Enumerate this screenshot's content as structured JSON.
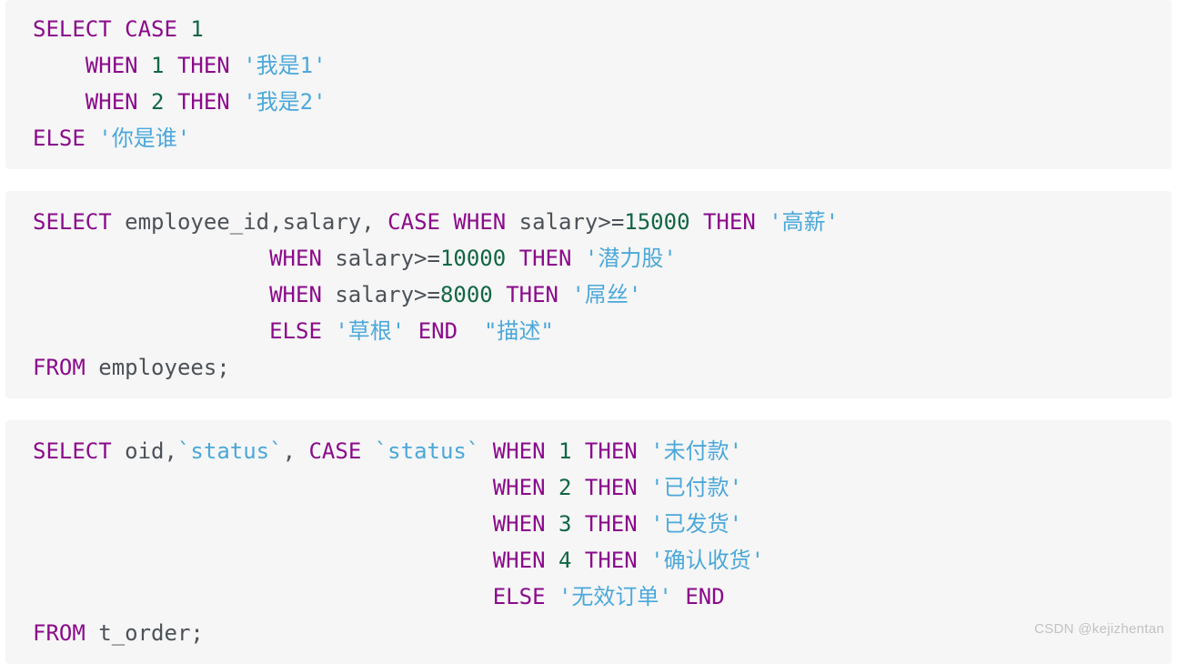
{
  "page": {
    "background_color": "#ffffff",
    "block_background_color": "#f6f6f6"
  },
  "syntax_colors": {
    "keyword": "#8b0a8b",
    "number": "#116644",
    "string": "#4ba8da",
    "identifier": "#4d5259",
    "operator": "#4d5259",
    "punctuation": "#4d5259"
  },
  "watermark": {
    "text": "CSDN @kejizhentan"
  },
  "code_blocks": [
    {
      "id": "block-case-simple",
      "plain_text": "SELECT CASE 1\n    WHEN 1 THEN '我是1'\n    WHEN 2 THEN '我是2'\nELSE '你是谁'",
      "lines": [
        {
          "indent": "",
          "tokens": [
            {
              "t": "SELECT",
              "k": "kw"
            },
            {
              "t": " ",
              "k": "pun"
            },
            {
              "t": "CASE",
              "k": "kw"
            },
            {
              "t": " ",
              "k": "pun"
            },
            {
              "t": "1",
              "k": "num"
            }
          ]
        },
        {
          "indent": "    ",
          "tokens": [
            {
              "t": "WHEN",
              "k": "kw"
            },
            {
              "t": " ",
              "k": "pun"
            },
            {
              "t": "1",
              "k": "num"
            },
            {
              "t": " ",
              "k": "pun"
            },
            {
              "t": "THEN",
              "k": "kw"
            },
            {
              "t": " ",
              "k": "pun"
            },
            {
              "t": "'我是1'",
              "k": "str"
            }
          ]
        },
        {
          "indent": "    ",
          "tokens": [
            {
              "t": "WHEN",
              "k": "kw"
            },
            {
              "t": " ",
              "k": "pun"
            },
            {
              "t": "2",
              "k": "num"
            },
            {
              "t": " ",
              "k": "pun"
            },
            {
              "t": "THEN",
              "k": "kw"
            },
            {
              "t": " ",
              "k": "pun"
            },
            {
              "t": "'我是2'",
              "k": "str"
            }
          ]
        },
        {
          "indent": "",
          "tokens": [
            {
              "t": "ELSE",
              "k": "kw"
            },
            {
              "t": " ",
              "k": "pun"
            },
            {
              "t": "'你是谁'",
              "k": "str"
            }
          ]
        }
      ]
    },
    {
      "id": "block-case-salary",
      "plain_text": "SELECT employee_id,salary, CASE WHEN salary>=15000 THEN '高薪'\n                  WHEN salary>=10000 THEN '潜力股'\n                  WHEN salary>=8000 THEN '屌丝'\n                  ELSE '草根' END  \"描述\"\nFROM employees;",
      "lines": [
        {
          "indent": "",
          "tokens": [
            {
              "t": "SELECT",
              "k": "kw"
            },
            {
              "t": " ",
              "k": "pun"
            },
            {
              "t": "employee_id",
              "k": "id"
            },
            {
              "t": ",",
              "k": "pun"
            },
            {
              "t": "salary",
              "k": "id"
            },
            {
              "t": ", ",
              "k": "pun"
            },
            {
              "t": "CASE",
              "k": "kw"
            },
            {
              "t": " ",
              "k": "pun"
            },
            {
              "t": "WHEN",
              "k": "kw"
            },
            {
              "t": " ",
              "k": "pun"
            },
            {
              "t": "salary",
              "k": "id"
            },
            {
              "t": ">=",
              "k": "op"
            },
            {
              "t": "15000",
              "k": "num"
            },
            {
              "t": " ",
              "k": "pun"
            },
            {
              "t": "THEN",
              "k": "kw"
            },
            {
              "t": " ",
              "k": "pun"
            },
            {
              "t": "'高薪'",
              "k": "str"
            }
          ]
        },
        {
          "indent": "                  ",
          "tokens": [
            {
              "t": "WHEN",
              "k": "kw"
            },
            {
              "t": " ",
              "k": "pun"
            },
            {
              "t": "salary",
              "k": "id"
            },
            {
              "t": ">=",
              "k": "op"
            },
            {
              "t": "10000",
              "k": "num"
            },
            {
              "t": " ",
              "k": "pun"
            },
            {
              "t": "THEN",
              "k": "kw"
            },
            {
              "t": " ",
              "k": "pun"
            },
            {
              "t": "'潜力股'",
              "k": "str"
            }
          ]
        },
        {
          "indent": "                  ",
          "tokens": [
            {
              "t": "WHEN",
              "k": "kw"
            },
            {
              "t": " ",
              "k": "pun"
            },
            {
              "t": "salary",
              "k": "id"
            },
            {
              "t": ">=",
              "k": "op"
            },
            {
              "t": "8000",
              "k": "num"
            },
            {
              "t": " ",
              "k": "pun"
            },
            {
              "t": "THEN",
              "k": "kw"
            },
            {
              "t": " ",
              "k": "pun"
            },
            {
              "t": "'屌丝'",
              "k": "str"
            }
          ]
        },
        {
          "indent": "                  ",
          "tokens": [
            {
              "t": "ELSE",
              "k": "kw"
            },
            {
              "t": " ",
              "k": "pun"
            },
            {
              "t": "'草根'",
              "k": "str"
            },
            {
              "t": " ",
              "k": "pun"
            },
            {
              "t": "END",
              "k": "kw"
            },
            {
              "t": "  ",
              "k": "pun"
            },
            {
              "t": "\"描述\"",
              "k": "str"
            }
          ]
        },
        {
          "indent": "",
          "tokens": [
            {
              "t": "FROM",
              "k": "kw"
            },
            {
              "t": " ",
              "k": "pun"
            },
            {
              "t": "employees",
              "k": "id"
            },
            {
              "t": ";",
              "k": "pun"
            }
          ]
        }
      ]
    },
    {
      "id": "block-case-order-status",
      "plain_text": "SELECT oid,`status`, CASE `status` WHEN 1 THEN '未付款'\n                                   WHEN 2 THEN '已付款'\n                                   WHEN 3 THEN '已发货'\n                                   WHEN 4 THEN '确认收货'\n                                   ELSE '无效订单' END\nFROM t_order;",
      "lines": [
        {
          "indent": "",
          "tokens": [
            {
              "t": "SELECT",
              "k": "kw"
            },
            {
              "t": " ",
              "k": "pun"
            },
            {
              "t": "oid",
              "k": "id"
            },
            {
              "t": ",",
              "k": "pun"
            },
            {
              "t": "`status`",
              "k": "str"
            },
            {
              "t": ", ",
              "k": "pun"
            },
            {
              "t": "CASE",
              "k": "kw"
            },
            {
              "t": " ",
              "k": "pun"
            },
            {
              "t": "`status`",
              "k": "str"
            },
            {
              "t": " ",
              "k": "pun"
            },
            {
              "t": "WHEN",
              "k": "kw"
            },
            {
              "t": " ",
              "k": "pun"
            },
            {
              "t": "1",
              "k": "num"
            },
            {
              "t": " ",
              "k": "pun"
            },
            {
              "t": "THEN",
              "k": "kw"
            },
            {
              "t": " ",
              "k": "pun"
            },
            {
              "t": "'未付款'",
              "k": "str"
            }
          ]
        },
        {
          "indent": "                                   ",
          "tokens": [
            {
              "t": "WHEN",
              "k": "kw"
            },
            {
              "t": " ",
              "k": "pun"
            },
            {
              "t": "2",
              "k": "num"
            },
            {
              "t": " ",
              "k": "pun"
            },
            {
              "t": "THEN",
              "k": "kw"
            },
            {
              "t": " ",
              "k": "pun"
            },
            {
              "t": "'已付款'",
              "k": "str"
            }
          ]
        },
        {
          "indent": "                                   ",
          "tokens": [
            {
              "t": "WHEN",
              "k": "kw"
            },
            {
              "t": " ",
              "k": "pun"
            },
            {
              "t": "3",
              "k": "num"
            },
            {
              "t": " ",
              "k": "pun"
            },
            {
              "t": "THEN",
              "k": "kw"
            },
            {
              "t": " ",
              "k": "pun"
            },
            {
              "t": "'已发货'",
              "k": "str"
            }
          ]
        },
        {
          "indent": "                                   ",
          "tokens": [
            {
              "t": "WHEN",
              "k": "kw"
            },
            {
              "t": " ",
              "k": "pun"
            },
            {
              "t": "4",
              "k": "num"
            },
            {
              "t": " ",
              "k": "pun"
            },
            {
              "t": "THEN",
              "k": "kw"
            },
            {
              "t": " ",
              "k": "pun"
            },
            {
              "t": "'确认收货'",
              "k": "str"
            }
          ]
        },
        {
          "indent": "                                   ",
          "tokens": [
            {
              "t": "ELSE",
              "k": "kw"
            },
            {
              "t": " ",
              "k": "pun"
            },
            {
              "t": "'无效订单'",
              "k": "str"
            },
            {
              "t": " ",
              "k": "pun"
            },
            {
              "t": "END",
              "k": "kw"
            }
          ]
        },
        {
          "indent": "",
          "tokens": [
            {
              "t": "FROM",
              "k": "kw"
            },
            {
              "t": " ",
              "k": "pun"
            },
            {
              "t": "t_order",
              "k": "id"
            },
            {
              "t": ";",
              "k": "pun"
            }
          ]
        }
      ]
    }
  ]
}
